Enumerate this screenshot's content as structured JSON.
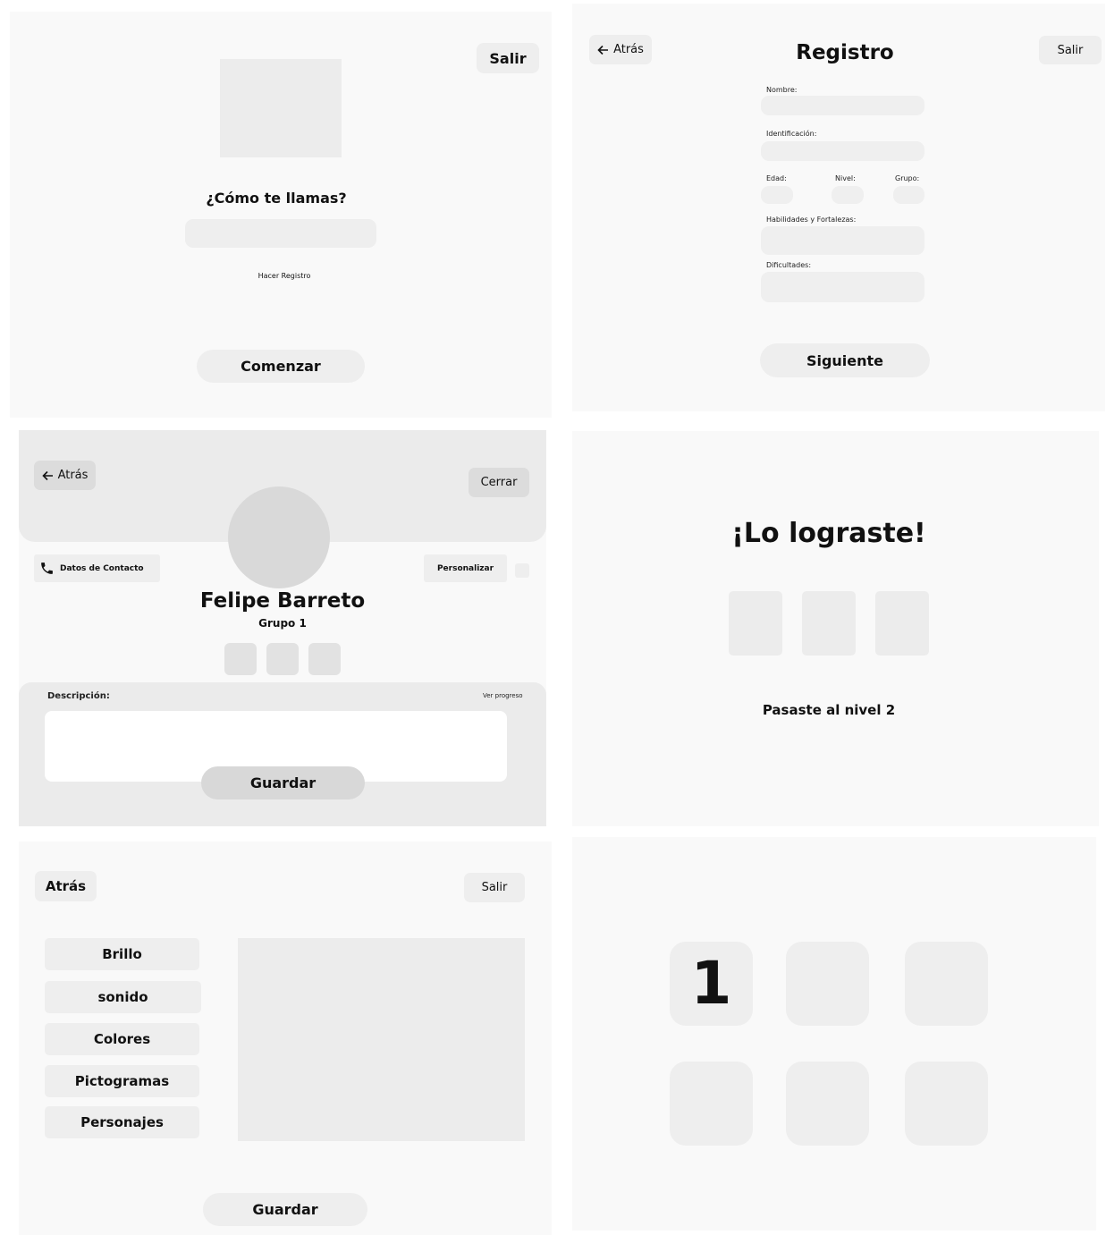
{
  "screen1": {
    "exit_label": "Salir",
    "question": "¿Cómo te llamas?",
    "name_value": "",
    "register_link": "Hacer Registro",
    "start_label": "Comenzar"
  },
  "screen2": {
    "back_label": "Atrás",
    "title": "Registro",
    "exit_label": "Salir",
    "fields": {
      "nombre": "Nombre:",
      "identificacion": "Identificación:",
      "edad": "Edad:",
      "nivel": "Nivel:",
      "grupo": "Grupo:",
      "habilidades": "Habilidades y Fortalezas:",
      "dificultades": "Dificultades:"
    },
    "next_label": "Siguiente"
  },
  "screen3": {
    "back_label": "Atrás",
    "close_label": "Cerrar",
    "contact_label": "Datos de Contacto",
    "customize_label": "Personalizar",
    "name": "Felipe Barreto",
    "group": "Grupo 1",
    "description_label": "Descripción:",
    "progress_link": "Ver progreso",
    "description_value": "",
    "save_label": "Guardar"
  },
  "screen4": {
    "title": "¡Lo lograste!",
    "message": "Pasaste al nivel 2"
  },
  "screen5": {
    "back_label": "Atrás",
    "exit_label": "Salir",
    "menu": [
      "Brillo",
      "sonido",
      "Colores",
      "Pictogramas",
      "Personajes"
    ],
    "save_label": "Guardar"
  },
  "screen6": {
    "level_tile_label": "1"
  },
  "icons": {
    "arrow": "arrow-left-icon",
    "phone": "phone-icon"
  },
  "colors": {
    "panel_bg": "#f9f9f9",
    "element_bg": "#eeeeee",
    "text": "#111111"
  }
}
